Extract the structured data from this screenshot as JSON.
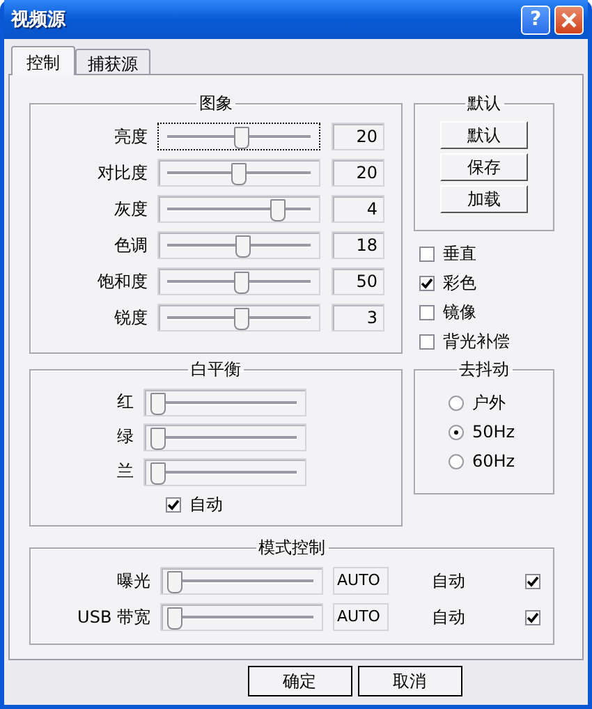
{
  "window": {
    "title": "视频源",
    "help_button": "?"
  },
  "tabs": [
    {
      "label": "控制",
      "selected": true
    },
    {
      "label": "捕获源",
      "selected": false
    }
  ],
  "image_group": {
    "title": "图象",
    "sliders": [
      {
        "label": "亮度",
        "level": 0.5,
        "value": "20",
        "focused": true
      },
      {
        "label": "对比度",
        "level": 0.48,
        "value": "20",
        "focused": false
      },
      {
        "label": "灰度",
        "level": 0.77,
        "value": "4",
        "focused": false
      },
      {
        "label": "色调",
        "level": 0.52,
        "value": "18",
        "focused": false
      },
      {
        "label": "饱和度",
        "level": 0.5,
        "value": "50",
        "focused": false
      },
      {
        "label": "锐度",
        "level": 0.5,
        "value": "3",
        "focused": false
      }
    ]
  },
  "defaults_group": {
    "title": "默认",
    "buttons": [
      "默认",
      "保存",
      "加载"
    ]
  },
  "options": [
    {
      "label": "垂直",
      "checked": false
    },
    {
      "label": "彩色",
      "checked": true
    },
    {
      "label": "镜像",
      "checked": false
    },
    {
      "label": "背光补偿",
      "checked": false
    }
  ],
  "white_balance": {
    "title": "白平衡",
    "sliders": [
      {
        "label": "红",
        "level": 0
      },
      {
        "label": "绿",
        "level": 0
      },
      {
        "label": "兰",
        "level": 0
      }
    ],
    "auto": {
      "label": "自动",
      "checked": true
    }
  },
  "flicker": {
    "title": "去抖动",
    "options": [
      {
        "label": "户外",
        "selected": false
      },
      {
        "label": "50Hz",
        "selected": true
      },
      {
        "label": "60Hz",
        "selected": false
      }
    ]
  },
  "mode_control": {
    "title": "模式控制",
    "rows": [
      {
        "label": "曝光",
        "level": 0,
        "value": "AUTO",
        "auto_label": "自动",
        "checked": true
      },
      {
        "label": "USB 带宽",
        "level": 0,
        "value": "AUTO",
        "auto_label": "自动",
        "checked": true
      }
    ]
  },
  "buttons": [
    "确定",
    "取消"
  ]
}
